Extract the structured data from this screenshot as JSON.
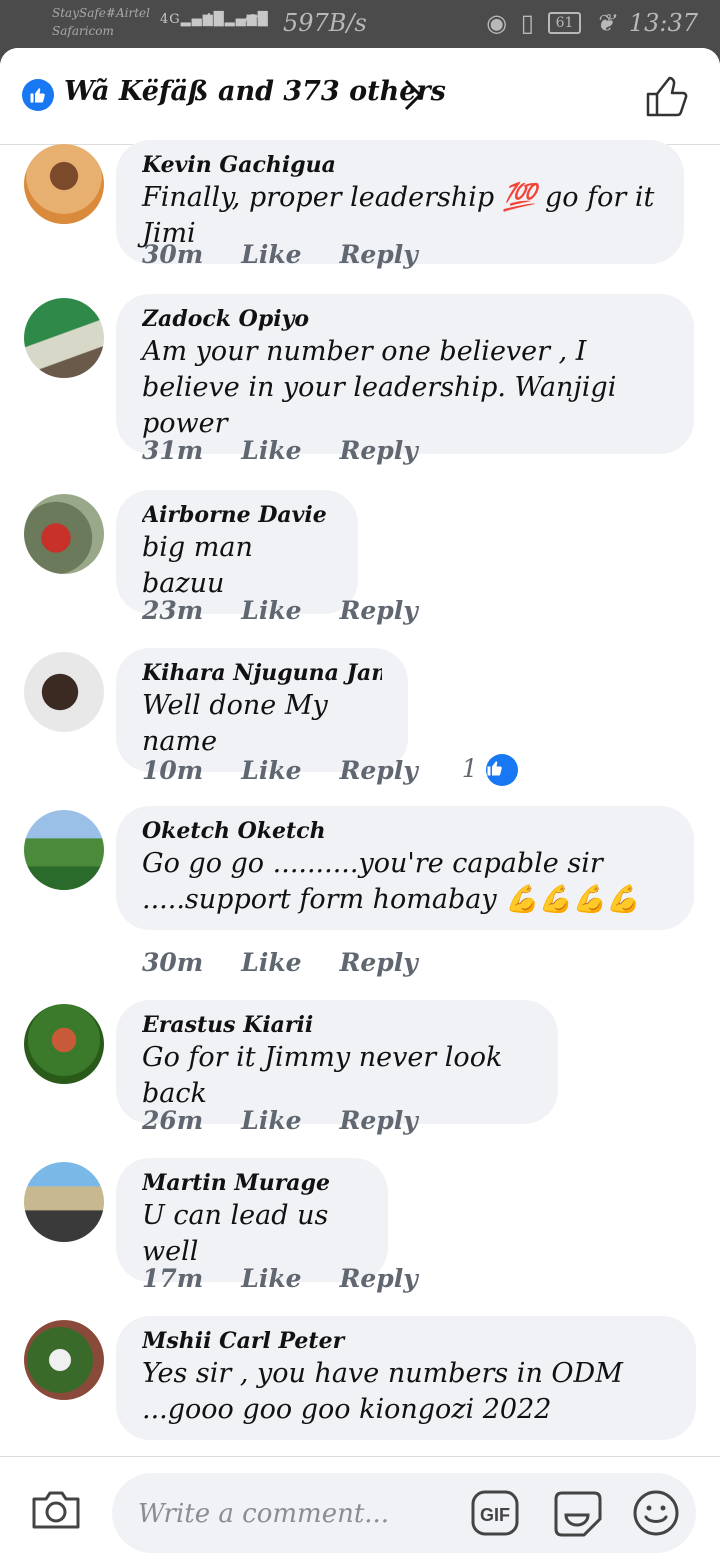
{
  "status_bar": {
    "carrier1": "StaySafe#Airtel",
    "carrier2": "Safaricom",
    "net1": "4G",
    "net2": "4G",
    "speed": "597B/s",
    "battery": "61",
    "time": "13:37"
  },
  "header": {
    "reactions_label": "Wã Këfäß and 373 others"
  },
  "comments": [
    {
      "name": "Kevin Gachigua",
      "text": "Finally, proper leadership 💯 go for it Jimi",
      "time": "30m",
      "like": "Like",
      "reply": "Reply"
    },
    {
      "name": "Zadock Opiyo",
      "text": "Am your number one believer , I believe in your leadership. Wanjigi power",
      "time": "31m",
      "like": "Like",
      "reply": "Reply"
    },
    {
      "name": "Airborne Davie",
      "text": "big man bazuu",
      "time": "23m",
      "like": "Like",
      "reply": "Reply"
    },
    {
      "name": "Kihara Njuguna James",
      "text": "Well done My name",
      "time": "10m",
      "like": "Like",
      "reply": "Reply",
      "reactions": "1"
    },
    {
      "name": "Oketch Oketch",
      "text": "Go go go ..........you're capable sir .....support form  homabay 💪💪💪💪",
      "time": "30m",
      "like": "Like",
      "reply": "Reply"
    },
    {
      "name": "Erastus Kiarii",
      "text": "Go for it Jimmy never look back",
      "time": "26m",
      "like": "Like",
      "reply": "Reply"
    },
    {
      "name": "Martin Murage",
      "text": "U can lead us well",
      "time": "17m",
      "like": "Like",
      "reply": "Reply"
    },
    {
      "name": "Mshii Carl Peter",
      "text": "Yes sir , you have numbers in ODM ...gooo goo goo kiongozi 2022",
      "time": "",
      "like": "",
      "reply": ""
    }
  ],
  "composer": {
    "placeholder": "Write a comment...",
    "gif_label": "GIF"
  },
  "colors": {
    "accent": "#1877f2",
    "bubble": "#f0f2f5",
    "meta": "#606770"
  }
}
